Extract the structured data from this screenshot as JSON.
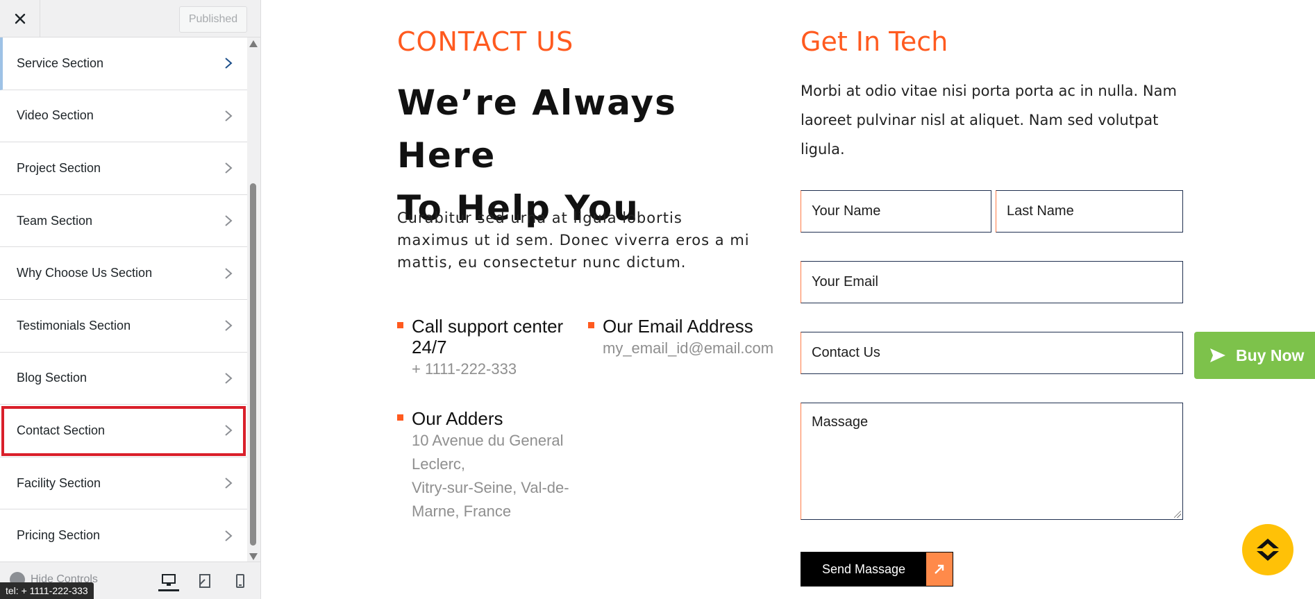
{
  "sidebar": {
    "published_label": "Published",
    "items": [
      {
        "label": "Service Section"
      },
      {
        "label": "Video Section"
      },
      {
        "label": "Project Section"
      },
      {
        "label": "Team Section"
      },
      {
        "label": "Why Choose Us Section"
      },
      {
        "label": "Testimonials Section"
      },
      {
        "label": "Blog Section"
      },
      {
        "label": "Contact Section"
      },
      {
        "label": "Facility Section"
      },
      {
        "label": "Pricing Section"
      }
    ],
    "footer": {
      "hide_controls_label": "Hide Controls",
      "devices": [
        "desktop-icon",
        "tablet-icon",
        "mobile-icon"
      ]
    },
    "status_tooltip": "tel: + 1111-222-333"
  },
  "preview": {
    "contact_tag": "CONTACT US",
    "heading_line1": "We’re Always Here",
    "heading_line2": "To Help You",
    "intro_line1": "Curabitur sed urna at ligula lobortis",
    "intro_line2": "maximus ut id sem. Donec viverra eros a mi",
    "intro_line3": "mattis, eu consectetur nunc dictum.",
    "call": {
      "title_line1": "Call support center",
      "title_line2": "24/7",
      "value": "+ 1111-222-333"
    },
    "email": {
      "title": "Our Email Address",
      "value": "my_email_id@email.com"
    },
    "address": {
      "title": "Our Adders",
      "line1": "10 Avenue du General",
      "line2": "Leclerc,",
      "line3": "Vitry-sur-Seine, Val-de-",
      "line4": "Marne, France"
    },
    "get_in_touch_title": "Get In Tech",
    "get_in_touch_line1": "Morbi at odio vitae nisi porta porta ac in nulla. Nam",
    "get_in_touch_line2": "laoreet pulvinar nisl at aliquet. Nam sed volutpat",
    "get_in_touch_line3": "ligula.",
    "form": {
      "first_name_placeholder": "Your Name",
      "last_name_placeholder": "Last Name",
      "email_placeholder": "Your Email",
      "subject_placeholder": "Contact Us",
      "message_placeholder": "Massage",
      "send_label": "Send Massage"
    },
    "buy_now_label": "Buy Now"
  },
  "colors": {
    "accent": "#ff5a1f",
    "buy_now": "#7dc24b",
    "scroll_top": "#ffc107",
    "highlight_box": "#d91f2a"
  }
}
